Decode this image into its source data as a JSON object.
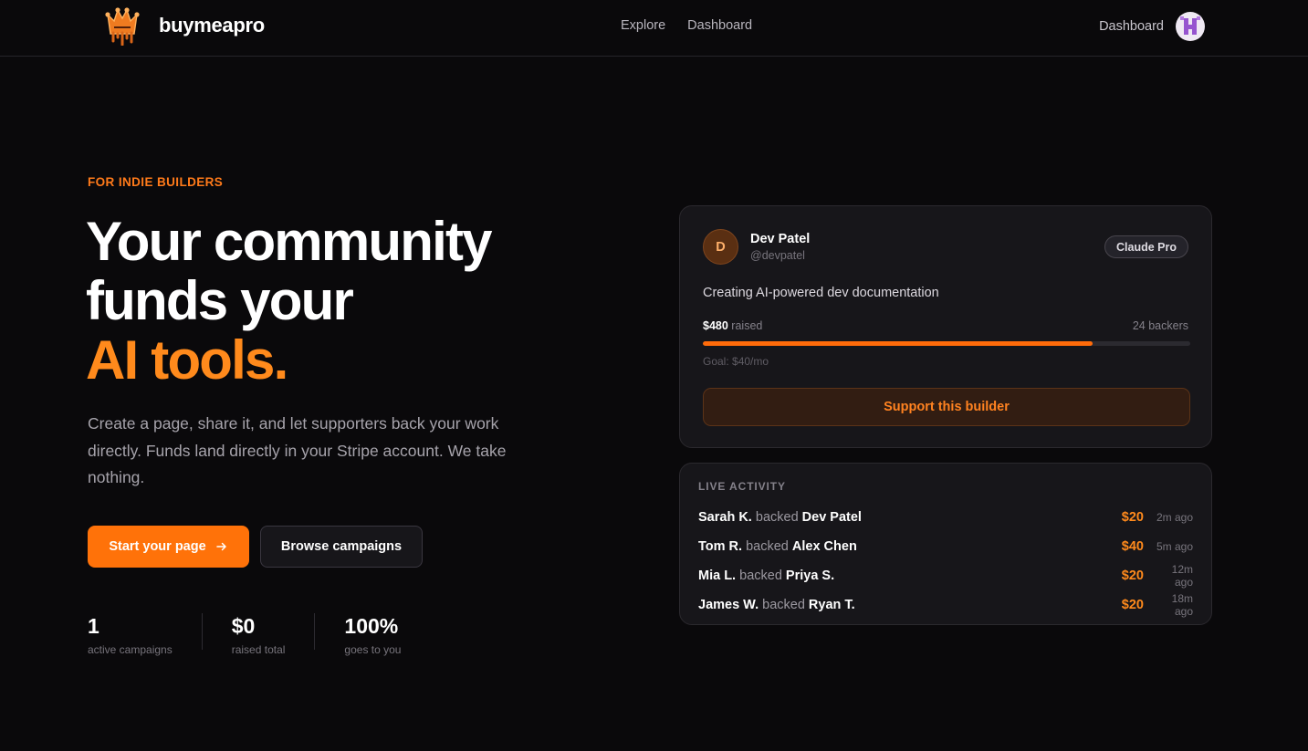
{
  "app": {
    "name": "buymeapro",
    "logo_icon": "crown-icon",
    "accent_color": "#ff7a1a"
  },
  "header": {
    "nav": [
      "Explore",
      "Dashboard"
    ],
    "account_link": "Dashboard",
    "avatar_icon": "user-avatar"
  },
  "hero": {
    "eyebrow": "FOR INDIE BUILDERS",
    "headline_lines": [
      "Your community",
      "funds your",
      "AI tools."
    ],
    "lead": "Create a page, share it, and let supporters back your work directly. Funds land directly in your Stripe account. We take nothing.",
    "primary_cta": "Start your page",
    "primary_cta_icon": "arrow-right-icon",
    "secondary_cta": "Browse campaigns",
    "stats": [
      {
        "value": "1",
        "label": "active campaigns"
      },
      {
        "value": "$0",
        "label": "raised total"
      },
      {
        "value": "100%",
        "label": "goes to you"
      }
    ]
  },
  "campaign": {
    "avatar_initial": "D",
    "name": "Dev Patel",
    "handle": "@devpatel",
    "tier": "Claude Pro",
    "description": "Creating AI-powered dev documentation",
    "raised_amount": "$480",
    "raised_label": "raised",
    "backers": "24 backers",
    "progress_percent": 80,
    "goal": "Goal: $40/mo",
    "button": "Support this builder"
  },
  "activity": {
    "title": "LIVE ACTIVITY",
    "connector": "backed",
    "items": [
      {
        "backer": "Sarah K.",
        "creator": "Dev Patel",
        "amount": "$20",
        "time": "2m ago"
      },
      {
        "backer": "Tom R.",
        "creator": "Alex Chen",
        "amount": "$40",
        "time": "5m ago"
      },
      {
        "backer": "Mia L.",
        "creator": "Priya S.",
        "amount": "$20",
        "time": "12m ago"
      },
      {
        "backer": "James W.",
        "creator": "Ryan T.",
        "amount": "$20",
        "time": "18m ago"
      }
    ]
  }
}
